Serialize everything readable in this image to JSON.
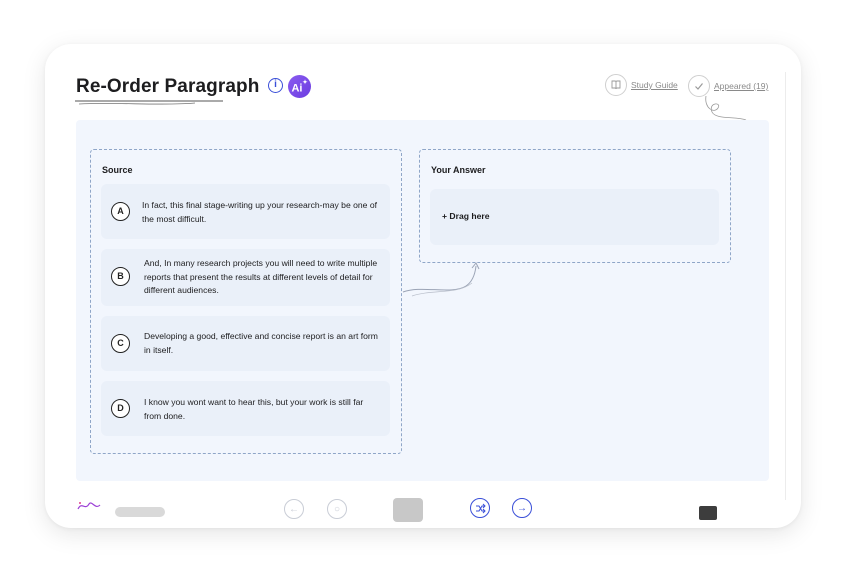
{
  "header": {
    "title": "Re-Order Paragraph",
    "info_icon": "i",
    "ai_badge": "Ai",
    "study_guide_label": "Study Guide",
    "appeared_label": "Appeared (19)"
  },
  "source": {
    "title": "Source",
    "items": [
      {
        "letter": "A",
        "text": "In fact, this final stage-writing up your research-may be one of the most difficult."
      },
      {
        "letter": "B",
        "text": "And, In many research projects you will need to write multiple reports that present the results at different levels of detail for different audiences."
      },
      {
        "letter": "C",
        "text": "Developing a good, effective and concise report is an art form in itself."
      },
      {
        "letter": "D",
        "text": "I know you wont want to hear this, but your work is still far from done."
      }
    ]
  },
  "answer": {
    "title": "Your Answer",
    "drop_label": "+ Drag here"
  },
  "colors": {
    "accent": "#3a4fd8",
    "ai_badge": "#7a4ce8",
    "panel_bg": "#f2f6fd",
    "item_bg": "#eaf0f9",
    "dash_border": "#8fa6c8"
  },
  "icons": [
    "info-icon",
    "ai-icon",
    "book-icon",
    "check-icon",
    "arrow-left-icon",
    "search-icon",
    "shuffle-icon",
    "arrow-right-icon"
  ]
}
